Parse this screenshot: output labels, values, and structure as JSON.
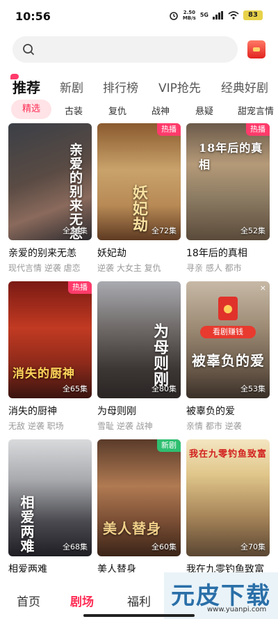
{
  "status_bar": {
    "time": "10:56",
    "net_speed_value": "2.50",
    "net_speed_unit": "MB/s",
    "signal": "5G",
    "battery": "83"
  },
  "search": {
    "placeholder": ""
  },
  "main_tabs": [
    "推荐",
    "新剧",
    "排行榜",
    "VIP抢先",
    "经典好剧"
  ],
  "categories": [
    "精选",
    "古装",
    "复仇",
    "战神",
    "悬疑",
    "甜宠言情"
  ],
  "colors": {
    "accent": "#ff2d55",
    "hot_badge": "#ff3b6b",
    "new_badge": "#2fbf71"
  },
  "dramas": [
    {
      "title": "亲爱的别来无恙",
      "tags": "现代言情 逆袭 虐恋",
      "episodes": "全36集",
      "badge": "",
      "poster_text": "亲爱的别来无恙"
    },
    {
      "title": "妖妃劫",
      "tags": "逆袭 大女主 复仇",
      "episodes": "全72集",
      "badge": "热播",
      "poster_text": "妖妃劫"
    },
    {
      "title": "18年后的真相",
      "tags": "寻亲 感人 都市",
      "episodes": "全52集",
      "badge": "热播",
      "poster_text": "18年后的真相"
    },
    {
      "title": "消失的厨神",
      "tags": "无敌 逆袭 职场",
      "episodes": "全65集",
      "badge": "热播",
      "poster_text": "消失的厨神"
    },
    {
      "title": "为母则刚",
      "tags": "雪耻 逆袭 战神",
      "episodes": "全80集",
      "badge": "",
      "poster_text": "为母则刚"
    },
    {
      "title": "被辜负的爱",
      "tags": "亲情 都市 逆袭",
      "episodes": "全53集",
      "badge": "",
      "poster_text": "被辜负的爱",
      "ad_label": "看剧赚钱",
      "close": "×"
    },
    {
      "title": "相爱两难",
      "tags": "",
      "episodes": "全68集",
      "badge": "",
      "poster_text": "相爱两难"
    },
    {
      "title": "美人替身",
      "tags": "",
      "episodes": "全60集",
      "badge": "新剧",
      "poster_text": "美人替身"
    },
    {
      "title": "我在九零钓鱼致富",
      "tags": "",
      "episodes": "全70集",
      "badge": "",
      "poster_text": "我在九零钓鱼致富"
    }
  ],
  "bottom_nav": [
    "首页",
    "剧场",
    "福利"
  ],
  "watermark": {
    "text": "元皮下载",
    "url": "www.yuanpi.com"
  }
}
